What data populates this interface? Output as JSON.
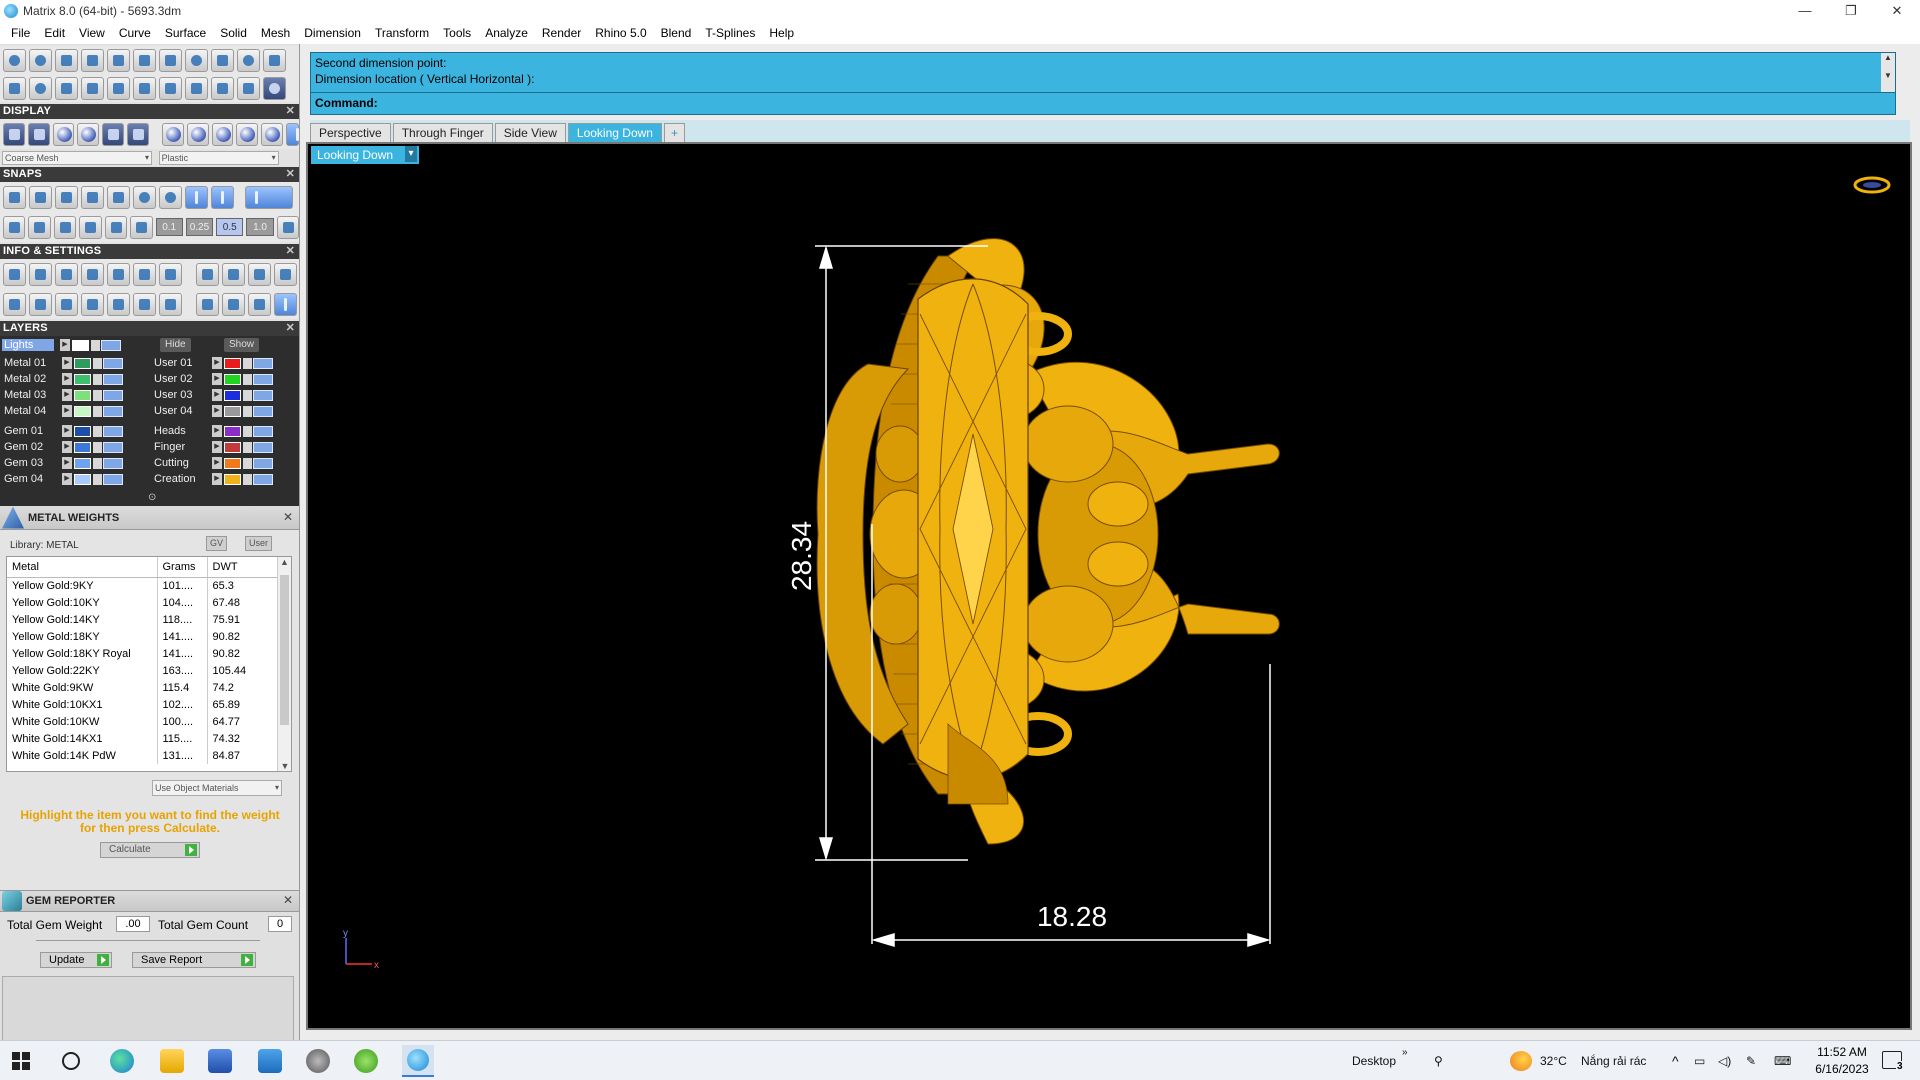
{
  "window": {
    "title": "Matrix 8.0 (64-bit) - 5693.3dm",
    "minimize": "—",
    "restore": "❐",
    "close": "✕"
  },
  "menu": [
    "File",
    "Edit",
    "View",
    "Curve",
    "Surface",
    "Solid",
    "Mesh",
    "Dimension",
    "Transform",
    "Tools",
    "Analyze",
    "Render",
    "Rhino 5.0",
    "Blend",
    "T-Splines",
    "Help"
  ],
  "display": {
    "header": "DISPLAY",
    "mesh_select": "Coarse Mesh",
    "material_select": "Plastic"
  },
  "snaps": {
    "header": "SNAPS",
    "increments": [
      "0.1",
      "0.25",
      "0.5",
      "1.0"
    ]
  },
  "info": {
    "header": "INFO & SETTINGS"
  },
  "layers": {
    "header": "LAYERS",
    "lights": "Lights",
    "hide": "Hide",
    "show": "Show",
    "left": [
      {
        "name": "Metal 01",
        "color": "#2e9c5c"
      },
      {
        "name": "Metal 02",
        "color": "#3fbf6e"
      },
      {
        "name": "Metal 03",
        "color": "#7de07a"
      },
      {
        "name": "Metal 04",
        "color": "#c8f5c4"
      },
      {
        "name": "Gem 01",
        "color": "#1e4fa8"
      },
      {
        "name": "Gem 02",
        "color": "#3b78d8"
      },
      {
        "name": "Gem 03",
        "color": "#6ea3f0"
      },
      {
        "name": "Gem 04",
        "color": "#a9c9ff"
      }
    ],
    "right": [
      {
        "name": "User 01",
        "color": "#e81c1c"
      },
      {
        "name": "User 02",
        "color": "#22d422"
      },
      {
        "name": "User 03",
        "color": "#1a2ee0"
      },
      {
        "name": "User 04",
        "color": "#9a9a9a"
      },
      {
        "name": "Heads",
        "color": "#8a2dc9"
      },
      {
        "name": "Finger",
        "color": "#c23a3a"
      },
      {
        "name": "Cutting",
        "color": "#f07a1c"
      },
      {
        "name": "Creation",
        "color": "#f0b21c"
      }
    ]
  },
  "metal_weights": {
    "header": "METAL WEIGHTS",
    "library": "Library: METAL",
    "gv": "GV",
    "user": "User",
    "columns": [
      "Metal",
      "Grams",
      "DWT"
    ],
    "rows": [
      [
        "Yellow Gold:9KY",
        "101....",
        "65.3"
      ],
      [
        "Yellow Gold:10KY",
        "104....",
        "67.48"
      ],
      [
        "Yellow Gold:14KY",
        "118....",
        "75.91"
      ],
      [
        "Yellow Gold:18KY",
        "141....",
        "90.82"
      ],
      [
        "Yellow Gold:18KY Royal",
        "141....",
        "90.82"
      ],
      [
        "Yellow Gold:22KY",
        "163....",
        "105.44"
      ],
      [
        "White Gold:9KW",
        "115.4",
        "74.2"
      ],
      [
        "White Gold:10KX1",
        "102....",
        "65.89"
      ],
      [
        "White Gold:10KW",
        "100....",
        "64.77"
      ],
      [
        "White Gold:14KX1",
        "115....",
        "74.32"
      ],
      [
        "White Gold:14K PdW",
        "131....",
        "84.87"
      ]
    ],
    "use_object_materials": "Use Object Materials",
    "hint": "Highlight the item you want to find the weight for then press Calculate.",
    "calculate": "Calculate"
  },
  "gem_reporter": {
    "header": "GEM REPORTER",
    "total_weight_label": "Total Gem Weight",
    "total_weight_value": ".00",
    "total_count_label": "Total Gem Count",
    "total_count_value": "0",
    "update": "Update",
    "save_report": "Save Report"
  },
  "command": {
    "history": [
      "Second dimension point:",
      "Dimension location ( Vertical  Horizontal ):"
    ],
    "label": "Command:"
  },
  "view_tabs": [
    "Perspective",
    "Through Finger",
    "Side View",
    "Looking Down",
    "+"
  ],
  "active_view": "Looking Down",
  "viewport": {
    "label": "Looking Down",
    "dim_vertical": "28.34",
    "dim_horizontal": "18.28",
    "axis_y": "y",
    "axis_x": "x",
    "model_color": "#f0b20e"
  },
  "taskbar": {
    "desktop": "Desktop",
    "weather_temp": "32°C",
    "weather_text": "Nắng rải rác",
    "time": "11:52 AM",
    "date": "6/16/2023",
    "notifications": "3"
  }
}
